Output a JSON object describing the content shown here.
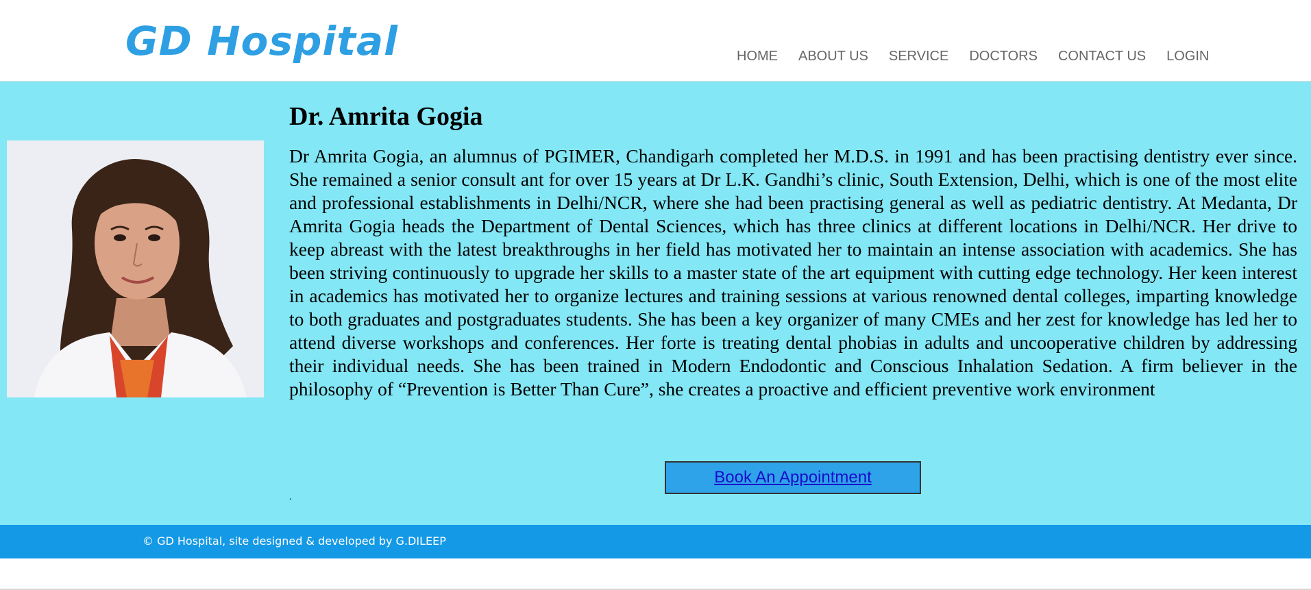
{
  "header": {
    "logo": "GD Hospital",
    "nav": [
      {
        "label": "HOME"
      },
      {
        "label": "ABOUT US"
      },
      {
        "label": "SERVICE"
      },
      {
        "label": "DOCTORS"
      },
      {
        "label": "CONTACT US"
      },
      {
        "label": "LOGIN"
      }
    ]
  },
  "doctor": {
    "name": "Dr. Amrita Gogia",
    "bio": "Dr Amrita Gogia, an alumnus of PGIMER, Chandigarh completed her M.D.S. in 1991 and has been practising dentistry ever since. She remained a senior consult ant for over 15 years at Dr L.K. Gandhi’s clinic, South Extension, Delhi, which is one of the most elite and professional establishments in Delhi/NCR, where she had been practising general as well as pediatric dentistry. At Medanta, Dr Amrita Gogia heads the Department of Dental Sciences, which has three clinics at different locations in Delhi/NCR. Her drive to keep abreast with the latest breakthroughs in her field has motivated her to maintain an intense association with academics. She has been striving continuously to upgrade her skills to a master state of the art equipment with cutting edge technology. Her keen interest in academics has motivated her to organize lectures and training sessions at various renowned dental colleges, imparting knowledge to both graduates and postgraduates students. She has been a key organizer of many CMEs and her zest for knowledge has led her to attend diverse workshops and conferences. Her forte is treating dental phobias in adults and uncooperative children by addressing their individual needs. She has been trained in Modern Endodontic and Conscious Inhalation Sedation. A firm believer in the philosophy of “Prevention is Better Than Cure”, she creates a proactive and efficient preventive work environment",
    "appointment_label": "Book An Appointment",
    "trailing_mark": "."
  },
  "footer": {
    "text": "© GD Hospital, site designed & developed by G.DILEEP"
  },
  "colors": {
    "brand": "#2e9fe3",
    "main_bg": "#83e7f5",
    "footer_bg": "#1499e6",
    "button_bg": "#2ea3ea"
  }
}
